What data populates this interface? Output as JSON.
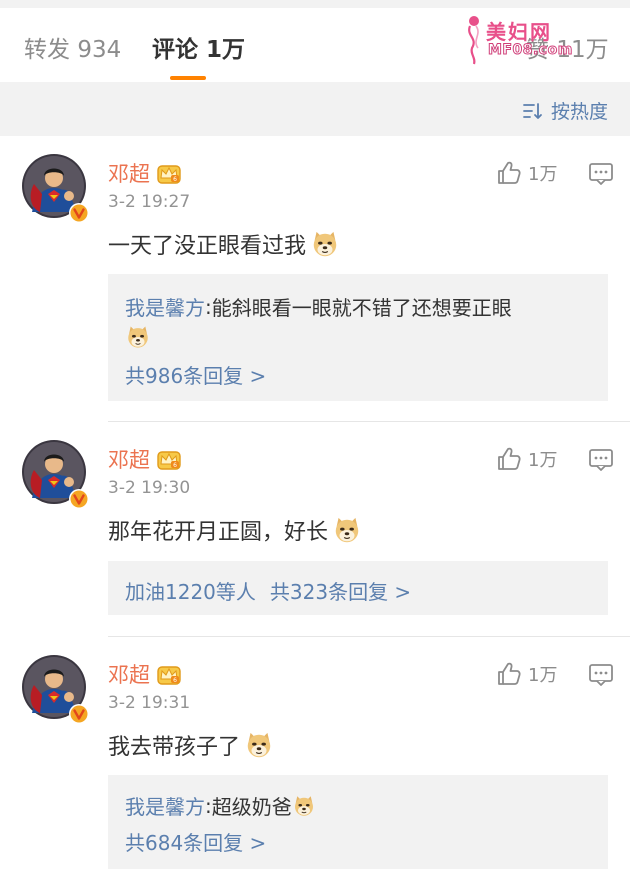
{
  "tabs": {
    "repost": {
      "label": "转发",
      "count": "934"
    },
    "comment": {
      "label": "评论",
      "count": "1万"
    },
    "like": {
      "label": "赞",
      "count": "11万"
    }
  },
  "watermark": {
    "cn": "美妇网",
    "en": "MF08.com"
  },
  "sort": {
    "label": "按热度"
  },
  "colors": {
    "accent": "#ff8200",
    "name": "#eb7350",
    "link": "#5b7fae",
    "vip": "#e6a23c",
    "verified": "#e2471c"
  },
  "comments": [
    {
      "name": "邓超",
      "time": "3-2 19:27",
      "likes": "1万",
      "text": "一天了没正眼看过我",
      "reply": {
        "user": "我是馨方",
        "sep": ": ",
        "text": "能斜眼看一眼就不错了还想要正眼"
      },
      "more": "共986条回复 >"
    },
    {
      "name": "邓超",
      "time": "3-2 19:30",
      "likes": "1万",
      "text": "那年花开月正圆，好长",
      "likers": "加油1220等人",
      "more": "共323条回复 >"
    },
    {
      "name": "邓超",
      "time": "3-2 19:31",
      "likes": "1万",
      "text": "我去带孩子了",
      "reply": {
        "user": "我是馨方",
        "sep": ": ",
        "text": "超级奶爸"
      },
      "more": "共684条回复 >"
    }
  ]
}
